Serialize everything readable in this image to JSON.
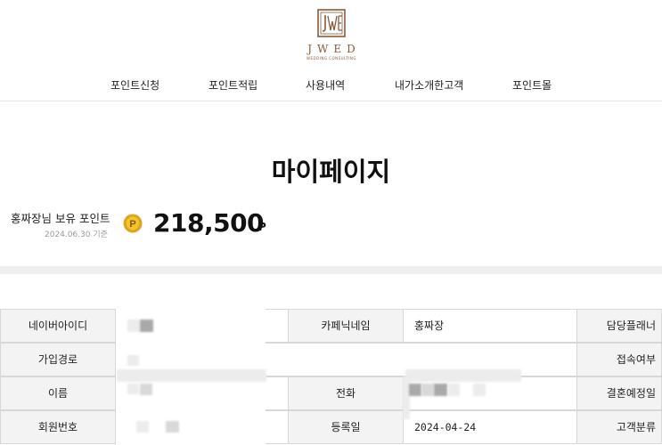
{
  "header": {
    "logo_text": "JWED",
    "logo_subtitle": "WEDDING CONSULTING",
    "nav": [
      "포인트신청",
      "포인트적립",
      "사용내역",
      "내가소개한고객",
      "포인트몰"
    ]
  },
  "page_title": "마이페이지",
  "points": {
    "label": "홍짜장님 보유 포인트",
    "as_of": "2024.06.30 기준",
    "coin_letter": "P",
    "value": "218,500",
    "unit": "P"
  },
  "info_table": {
    "rows": [
      {
        "label": "네이버아이디",
        "label2": "카페닉네임",
        "value2": "홍짜장",
        "label3": "담당플래너"
      },
      {
        "label": "가입경로",
        "label3": "접속여부"
      },
      {
        "label": "이름",
        "label2": "전화",
        "label3": "결혼예정일"
      },
      {
        "label": "회원번호",
        "label2": "등록일",
        "value2": "2024-04-24",
        "label3": "고객분류"
      }
    ]
  },
  "colors": {
    "brand": "#8a5a3c",
    "coin": "#e0a81a",
    "label_bg": "#f3f3f3",
    "border": "#d7d7d7"
  }
}
